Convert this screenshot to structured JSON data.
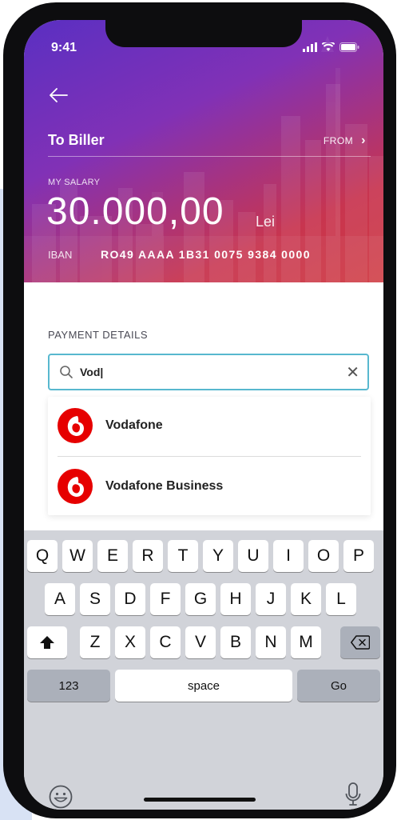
{
  "status_bar": {
    "time": "9:41"
  },
  "header": {
    "title": "To Biller",
    "from_label": "FROM",
    "account_label": "MY SALARY",
    "amount": "30.000,00",
    "currency": "Lei",
    "iban_label": "IBAN",
    "iban_value": "RO49 AAAA 1B31 0075 9384 0000"
  },
  "payment": {
    "section_title": "PAYMENT DETAILS",
    "search_value": "Vod|",
    "results": [
      {
        "label": "Vodafone",
        "icon": "vodafone-logo-icon"
      },
      {
        "label": "Vodafone Business",
        "icon": "vodafone-logo-icon"
      }
    ]
  },
  "keyboard": {
    "row1": [
      "Q",
      "W",
      "E",
      "R",
      "T",
      "Y",
      "U",
      "I",
      "O",
      "P"
    ],
    "row2": [
      "A",
      "S",
      "D",
      "F",
      "G",
      "H",
      "J",
      "K",
      "L"
    ],
    "row3": [
      "Z",
      "X",
      "C",
      "V",
      "B",
      "N",
      "M"
    ],
    "numbers_key": "123",
    "space_key": "space",
    "go_key": "Go",
    "icons": [
      "shift-icon",
      "backspace-icon",
      "emoji-icon",
      "microphone-icon"
    ]
  },
  "colors": {
    "header_gradient_start": "#5a2fc2",
    "header_gradient_end": "#d03a42",
    "search_border": "#58b8cf",
    "vodafone_red": "#e60000",
    "keyboard_bg": "#d1d3d9"
  }
}
